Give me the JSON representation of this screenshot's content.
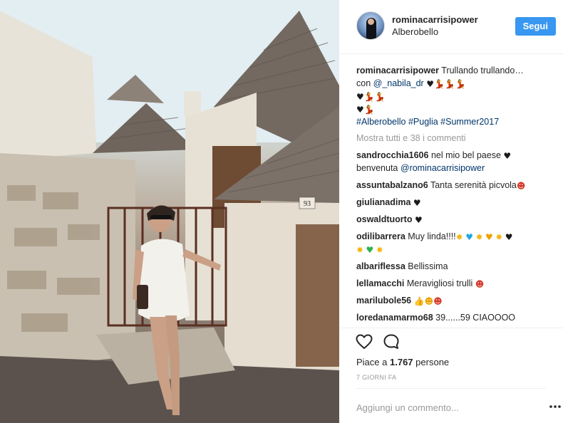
{
  "post": {
    "photo_alt": "Photo of a woman in a white dress standing before trulli houses",
    "author": {
      "username": "rominacarrisipower",
      "location": "Alberobello"
    },
    "follow_label": "Segui"
  },
  "caption": {
    "username": "rominacarrisipower",
    "text": "Trullando trullando…",
    "line2_prefix": "con ",
    "mention": "@_nabila_dr",
    "hashtag1": "#Alberobello",
    "hashtag2": "#Puglia",
    "hashtag3": "#Summer2017"
  },
  "view_all_comments": "Mostra tutti e 38 i commenti",
  "comments": [
    {
      "user": "sandrocchia1606",
      "text": "nel mio bel paese",
      "text2": "benvenuta",
      "mention": "@rominacarrisipower"
    },
    {
      "user": "assuntabalzano6",
      "text": "Tanta serenità picvola"
    },
    {
      "user": "giulianadima",
      "text": ""
    },
    {
      "user": "oswaldtuorto",
      "text": ""
    },
    {
      "user": "odilibarrera",
      "text": "Muy linda!!!!"
    },
    {
      "user": "albariflessa",
      "text": "Bellissima"
    },
    {
      "user": "lellamacchi",
      "text": "Meravigliosi trulli"
    },
    {
      "user": "marilubole56",
      "text": ""
    },
    {
      "user": "loredanamarmo68",
      "text": "39......59 CIAOOOO"
    }
  ],
  "likes": {
    "prefix": "Piace a",
    "count": "1.767",
    "suffix": "persone"
  },
  "timestamp": "7 GIORNI FA",
  "add_comment_placeholder": "Aggiungi un commento...",
  "icons": {
    "like": "heart-outline-icon",
    "comment": "speech-bubble-icon",
    "more": "ellipsis-icon"
  },
  "colors": {
    "follow_button": "#3897f0",
    "hashtag": "#003569",
    "muted": "#999999"
  }
}
